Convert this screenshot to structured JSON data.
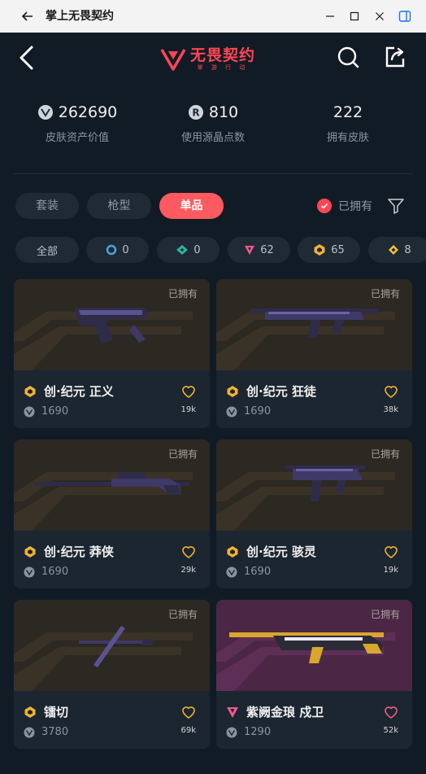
{
  "window": {
    "title": "掌上无畏契约"
  },
  "header": {
    "logo_main": "无畏契约",
    "logo_sub": "掌 游 行 动"
  },
  "stats": [
    {
      "value": "262690",
      "label": "皮肤资产价值",
      "icon": "vp-coin-icon"
    },
    {
      "value": "810",
      "label": "使用源晶点数",
      "icon": "radianite-icon"
    },
    {
      "value": "222",
      "label": "拥有皮肤",
      "icon": ""
    }
  ],
  "tabs": [
    {
      "label": "套装",
      "active": false
    },
    {
      "label": "枪型",
      "active": false
    },
    {
      "label": "单品",
      "active": true
    }
  ],
  "owned_filter": {
    "label": "已拥有",
    "checked": true
  },
  "rarity_chips": [
    {
      "label": "全部",
      "icon": ""
    },
    {
      "label": "0",
      "icon": "select-tier-icon",
      "color": "#4aa3df"
    },
    {
      "label": "0",
      "icon": "deluxe-tier-icon",
      "color": "#2fb3a0"
    },
    {
      "label": "62",
      "icon": "ultra-tier-icon",
      "color": "#f05a8a"
    },
    {
      "label": "65",
      "icon": "exclusive-tier-icon",
      "color": "#f2b233"
    },
    {
      "label": "8",
      "icon": "premium-tier-icon",
      "color": "#f2c037"
    }
  ],
  "cards": [
    {
      "name": "创·纪元 正义",
      "price": "1690",
      "likes": "19k",
      "owned": "已拥有",
      "tier": "exclusive"
    },
    {
      "name": "创·纪元 狂徒",
      "price": "1690",
      "likes": "38k",
      "owned": "已拥有",
      "tier": "exclusive"
    },
    {
      "name": "创·纪元 莽侠",
      "price": "1690",
      "likes": "29k",
      "owned": "已拥有",
      "tier": "exclusive"
    },
    {
      "name": "创·纪元 骇灵",
      "price": "1690",
      "likes": "19k",
      "owned": "已拥有",
      "tier": "exclusive"
    },
    {
      "name": "镭切",
      "price": "3780",
      "likes": "69k",
      "owned": "已拥有",
      "tier": "exclusive"
    },
    {
      "name": "紫阙金琅 戍卫",
      "price": "1290",
      "likes": "52k",
      "owned": "已拥有",
      "tier": "ultra"
    }
  ],
  "colors": {
    "accent": "#ff4655",
    "active_tab": "#ff5a5f",
    "exclusive": "#f2b233",
    "ultra": "#f05a8a"
  }
}
